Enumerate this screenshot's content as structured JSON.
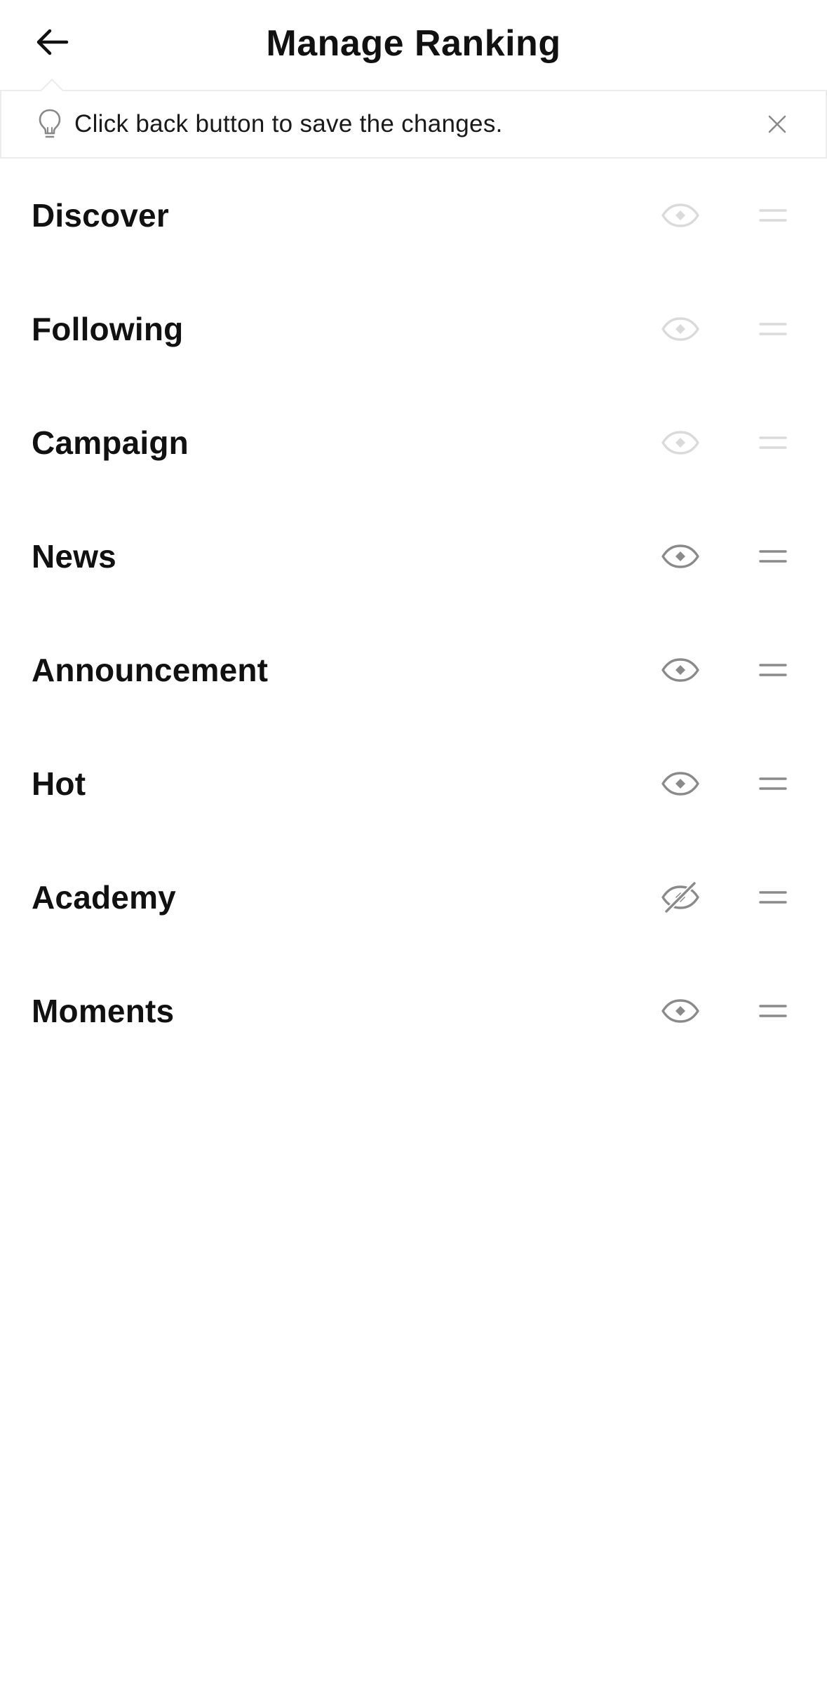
{
  "header": {
    "title": "Manage Ranking",
    "back_icon": "arrow-left-icon"
  },
  "tip": {
    "icon": "lightbulb-icon",
    "text": "Click back button to save the changes.",
    "close_icon": "close-icon"
  },
  "colors": {
    "locked_icon": "#dadada",
    "active_icon": "#8a8a8a",
    "text": "#111111",
    "divider": "#ececec"
  },
  "rows": [
    {
      "label": "Discover",
      "visibility": "visible",
      "locked": true
    },
    {
      "label": "Following",
      "visibility": "visible",
      "locked": true
    },
    {
      "label": "Campaign",
      "visibility": "visible",
      "locked": true
    },
    {
      "label": "News",
      "visibility": "visible",
      "locked": false
    },
    {
      "label": "Announcement",
      "visibility": "visible",
      "locked": false
    },
    {
      "label": "Hot",
      "visibility": "visible",
      "locked": false
    },
    {
      "label": "Academy",
      "visibility": "hidden",
      "locked": false
    },
    {
      "label": "Moments",
      "visibility": "visible",
      "locked": false
    }
  ]
}
